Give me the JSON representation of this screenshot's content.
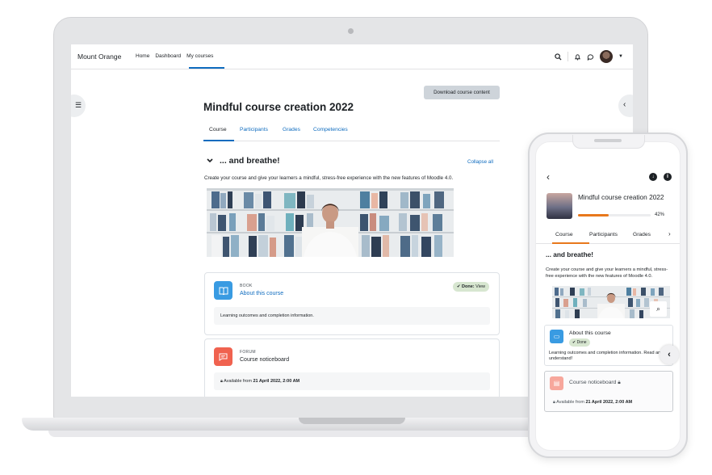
{
  "laptop": {
    "brand": "Mount Orange",
    "nav": {
      "home": "Home",
      "dashboard": "Dashboard",
      "my_courses": "My courses"
    },
    "icons": {
      "search": "⌕",
      "bell": "🔔︎",
      "chat": "💬︎",
      "chevron": "⌄"
    },
    "download_button": "Download course content",
    "course_title": "Mindful course creation 2022",
    "tabs": [
      "Course",
      "Participants",
      "Grades",
      "Competencies"
    ],
    "section_title": "... and breathe!",
    "collapse_all": "Collapse all",
    "intro": "Create your course and give your learners a mindful, stress-free experience with the new features of Moodle 4.0.",
    "activities": [
      {
        "type": "BOOK",
        "name": "About this course",
        "done_label": "Done:",
        "done_value": "View",
        "info": "Learning outcomes and completion information."
      },
      {
        "type": "FORUM",
        "name": "Course noticeboard",
        "avail_prefix": "Available from",
        "avail_date": "21 April 2022, 2:00 AM"
      }
    ]
  },
  "phone": {
    "course_title": "Mindful course creation 2022",
    "progress_percent": 42,
    "progress_label": "42%",
    "tabs": [
      "Course",
      "Participants",
      "Grades"
    ],
    "section_title": "... and breathe!",
    "intro": "Create your course and give your learners a mindful, stress-free experience with the new features of Moodle 4.0.",
    "book_name": "About this course",
    "done_label": "Done",
    "book_info": "Learning outcomes and completion information. Read and understand!",
    "forum_name": "Course noticeboard",
    "avail_prefix": "Available from",
    "avail_date": "21 April 2022, 2:00 AM"
  },
  "colors": {
    "accent": "#0f6cbf",
    "progress": "#e8781c",
    "book": "#399be2",
    "forum": "#f0624f"
  }
}
